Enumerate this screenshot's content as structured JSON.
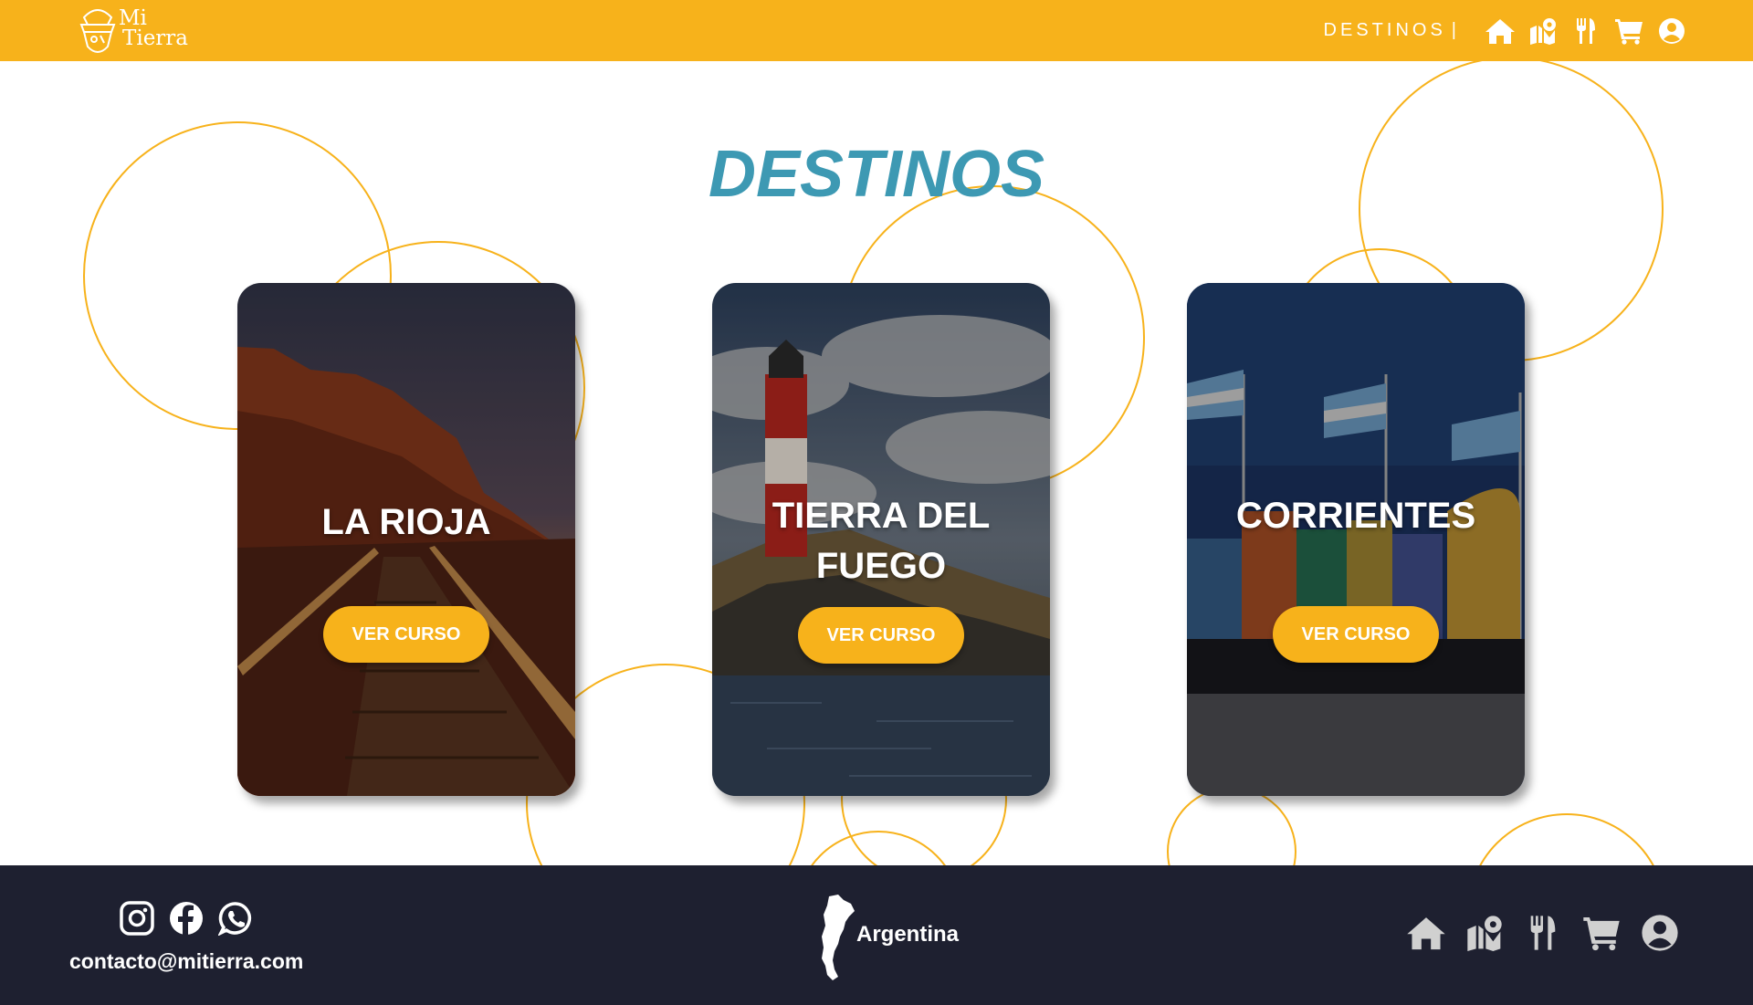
{
  "header": {
    "logo_line1": "Mi",
    "logo_line2": "Tierra",
    "nav_link": "DESTINOS",
    "separator": "|",
    "icons": [
      "home-icon",
      "map-icon",
      "utensils-icon",
      "cart-icon",
      "user-icon"
    ]
  },
  "main": {
    "title": "DESTINOS",
    "cards": [
      {
        "name": "LA RIOJA",
        "button": "VER CURSO"
      },
      {
        "name": "TIERRA DEL FUEGO",
        "button": "VER CURSO"
      },
      {
        "name": "CORRIENTES",
        "button": "VER CURSO"
      }
    ]
  },
  "footer": {
    "social_icons": [
      "instagram-icon",
      "facebook-icon",
      "whatsapp-icon"
    ],
    "email": "contacto@mitierra.com",
    "country": "Argentina",
    "icons": [
      "home-icon",
      "map-icon",
      "utensils-icon",
      "cart-icon",
      "user-icon"
    ]
  },
  "colors": {
    "primary": "#F7B21B",
    "title": "#3D99B3",
    "footer_bg": "#1E2030",
    "text_light": "#FFFFFF"
  }
}
